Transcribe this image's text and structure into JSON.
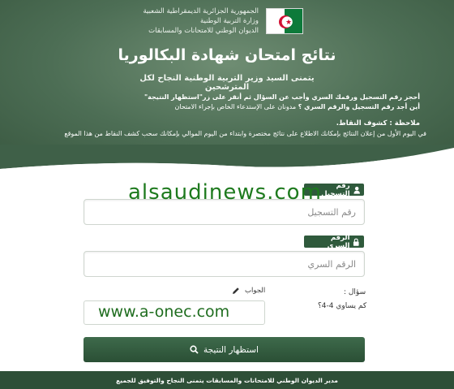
{
  "header": {
    "ministry_lines": [
      "الجمهورية الجزائرية الديمقراطية الشعبية",
      "وزارة التربية الوطنية",
      "الديوان الوطني للامتحانات والمسابقات"
    ],
    "title": "نتائج امتحان شهادة البكالوريا",
    "subtitle": "يتمنى السيد وزير التربية الوطنية النجاح لكل المترشحين",
    "instruction_1": "أحجز رقم التسجيل ورقمك السري وأجب عن السؤال ثم أنقر على زر\"استظهار النتيجة\"",
    "instruction_2_bold": "أين أجد رقم التسجيل والرقم السري ؟",
    "instruction_2_rest": "مدونان على الإستدعاء الخاص بإجراء الامتحان",
    "note_title": "ملاحظة : كشوف النقاط.",
    "note_body": "في اليوم الأول من إعلان النتائج بإمكانك الاطلاع على نتائج مختصرة وابتداء من اليوم الموالي بإمكانك سحب كشف النقاط من هذا الموقع"
  },
  "form": {
    "registration_label": "رقم التسجيل",
    "registration_placeholder": "رقم التسجيل",
    "secret_label": "الرقم السري",
    "secret_placeholder": "الرقم السري",
    "question_label": "سؤال :",
    "question_text": "كم يساوي 4-4؟",
    "answer_label": "الجواب",
    "submit_label": "استظهار النتيجة"
  },
  "footer": {
    "text": "مدير الديوان الوطني للامتحانات والمسابقات يتمنى النجاح والتوفيق للجميع"
  },
  "watermarks": {
    "top": "alsaudinews.com",
    "bottom": "www.a-onec.com"
  },
  "icons": {
    "registration": "user-icon",
    "secret": "lock-icon",
    "answer": "pencil-icon",
    "submit": "search-icon"
  },
  "colors": {
    "header_green": "#4d6e55",
    "label_green": "#2f5a3c",
    "button_green": "#2a4f35",
    "footer_green": "#2e4f37",
    "flag_green": "#0d7a3a",
    "flag_red": "#d21034"
  }
}
